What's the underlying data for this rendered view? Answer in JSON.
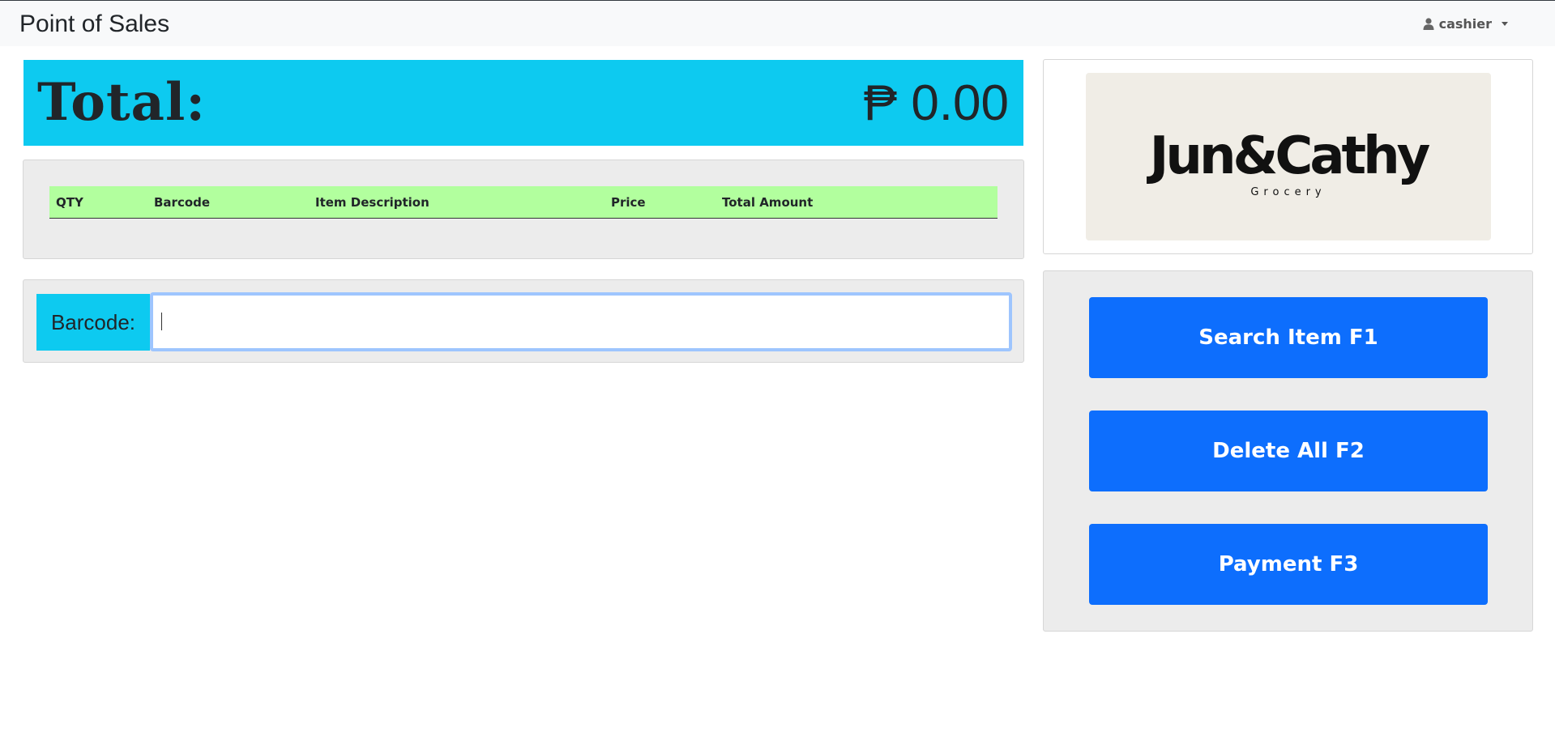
{
  "navbar": {
    "brand": "Point of Sales",
    "user": "cashier",
    "user_icon": "user-icon"
  },
  "total": {
    "label": "Total:",
    "amount": "₱ 0.00"
  },
  "cart_table": {
    "columns": [
      "QTY",
      "Barcode",
      "Item Description",
      "Price",
      "Total Amount"
    ],
    "rows": []
  },
  "barcode": {
    "label": "Barcode:",
    "value": "",
    "placeholder": ""
  },
  "logo": {
    "main": "Jun&Cathy",
    "sub": "Grocery"
  },
  "actions": {
    "search": "Search Item F1",
    "delete_all": "Delete All F2",
    "payment": "Payment F3"
  },
  "colors": {
    "navbar_bg": "#f8f9fa",
    "total_bg": "#0dcaf0",
    "table_header_bg": "#b2ff9e",
    "button_bg": "#0d6efd",
    "card_bg": "#ececec"
  }
}
